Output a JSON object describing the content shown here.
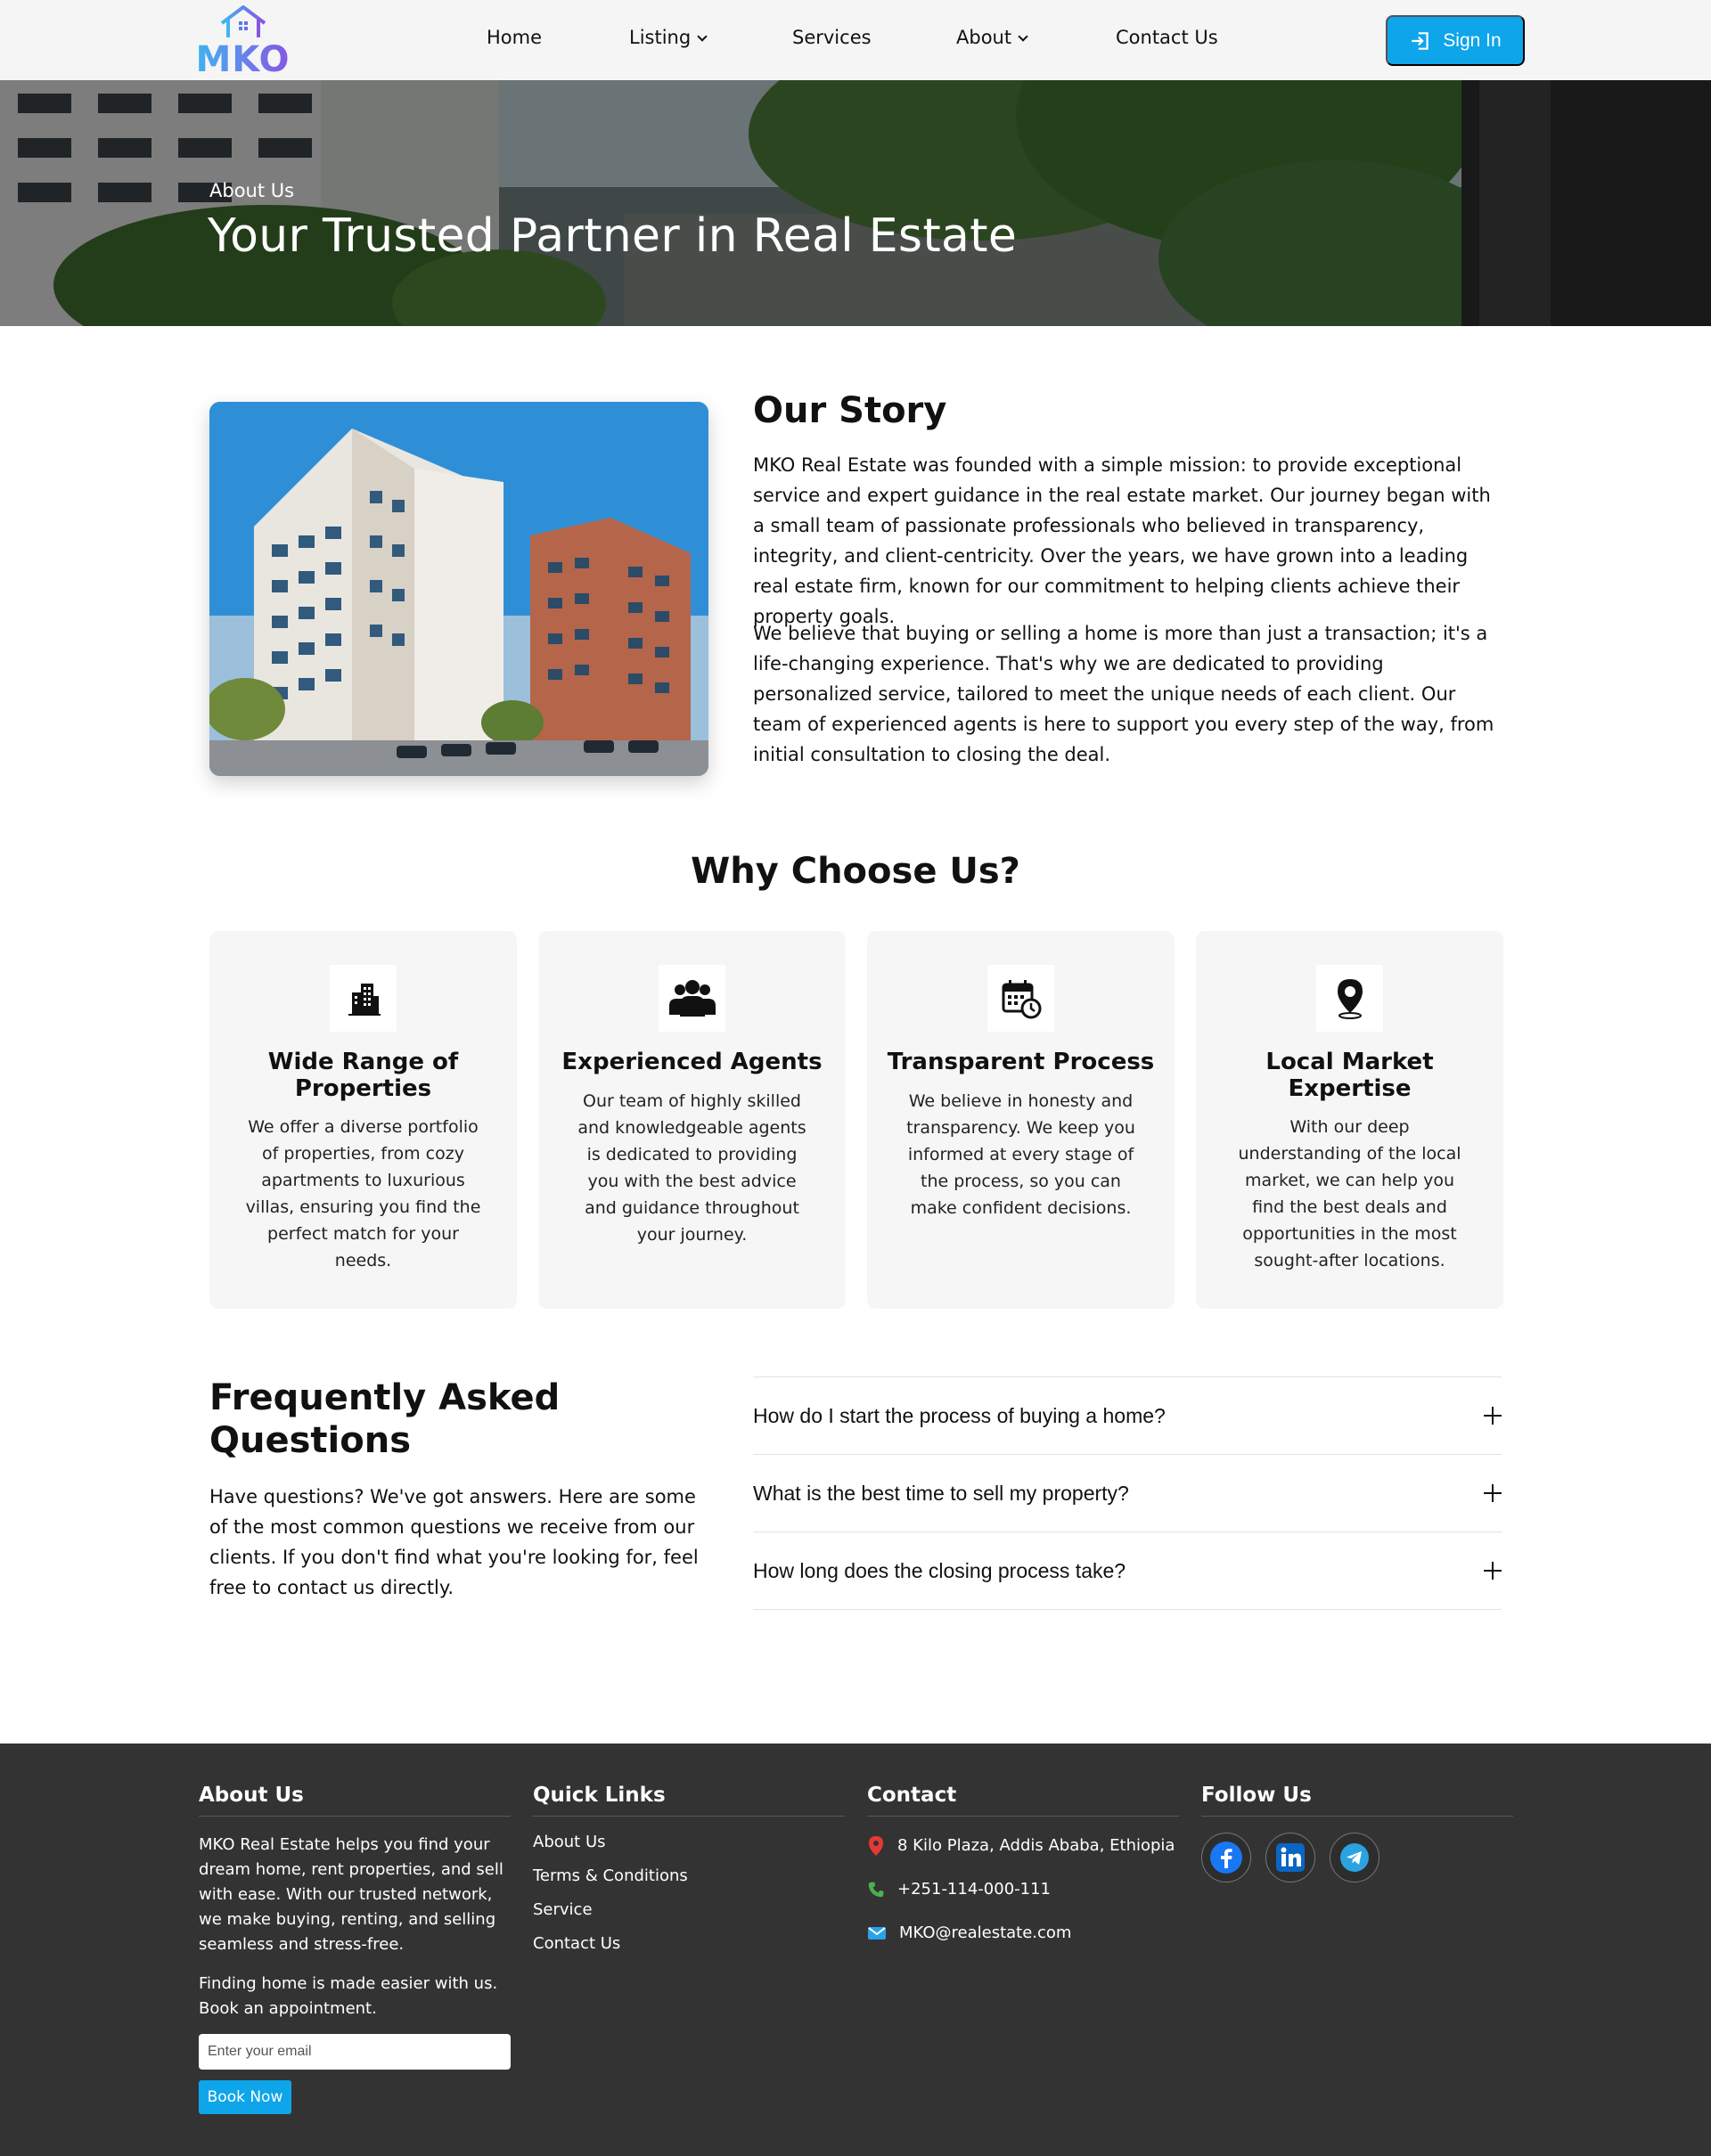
{
  "brand": {
    "name": "MKO"
  },
  "nav": {
    "items": [
      {
        "label": "Home",
        "dropdown": false
      },
      {
        "label": "Listing",
        "dropdown": true
      },
      {
        "label": "Services",
        "dropdown": false
      },
      {
        "label": "About",
        "dropdown": true
      },
      {
        "label": "Contact Us",
        "dropdown": false
      }
    ],
    "signin_label": "Sign In"
  },
  "hero": {
    "eyebrow": "About Us",
    "title": "Your Trusted Partner in Real Estate"
  },
  "story": {
    "title": "Our Story",
    "paragraphs": [
      "MKO Real Estate was founded with a simple mission: to provide exceptional service and expert guidance in the real estate market. Our journey began with a small team of passionate professionals who believed in transparency, integrity, and client-centricity. Over the years, we have grown into a leading real estate firm, known for our commitment to helping clients achieve their property goals.",
      "We believe that buying or selling a home is more than just a transaction; it's a life-changing experience. That's why we are dedicated to providing personalized service, tailored to meet the unique needs of each client. Our team of experienced agents is here to support you every step of the way, from initial consultation to closing the deal."
    ]
  },
  "why": {
    "title": "Why Choose Us?",
    "cards": [
      {
        "icon": "building-icon",
        "title": "Wide Range of Properties",
        "text": "We offer a diverse portfolio of properties, from cozy apartments to luxurious villas, ensuring you find the perfect match for your needs."
      },
      {
        "icon": "team-icon",
        "title": "Experienced Agents",
        "text": "Our team of highly skilled and knowledgeable agents is dedicated to providing you with the best advice and guidance throughout your journey."
      },
      {
        "icon": "calendar-clock-icon",
        "title": "Transparent Process",
        "text": "We believe in honesty and transparency. We keep you informed at every stage of the process, so you can make confident decisions."
      },
      {
        "icon": "map-pin-icon",
        "title": "Local Market Expertise",
        "text": "With our deep understanding of the local market, we can help you find the best deals and opportunities in the most sought-after locations."
      }
    ]
  },
  "faq": {
    "title": "Frequently Asked Questions",
    "description": "Have questions? We've got answers. Here are some of the most common questions we receive from our clients. If you don't find what you're looking for, feel free to contact us directly.",
    "items": [
      "How do I start the process of buying a home?",
      "What is the best time to sell my property?",
      "How long does the closing process take?"
    ]
  },
  "footer": {
    "about": {
      "title": "About Us",
      "text": "MKO Real Estate helps you find your dream home, rent properties, and sell with ease. With our trusted network, we make buying, renting, and selling seamless and stress-free.",
      "cta_text": "Finding home is made easier with us. Book an appointment.",
      "email_placeholder": "Enter your email",
      "button_label": "Book Now"
    },
    "quick_links": {
      "title": "Quick Links",
      "items": [
        "About Us",
        "Terms & Conditions",
        "Service",
        "Contact Us"
      ]
    },
    "contact": {
      "title": "Contact",
      "address": "8 Kilo Plaza, Addis Ababa, Ethiopia",
      "phone": "+251-114-000-111",
      "email": "MKO@realestate.com"
    },
    "follow": {
      "title": "Follow Us",
      "networks": [
        "facebook-icon",
        "linkedin-icon",
        "telegram-icon"
      ]
    }
  },
  "colors": {
    "accent": "#0ea5ea",
    "footer_bg": "#333333",
    "card_bg": "#f6f6f6"
  }
}
